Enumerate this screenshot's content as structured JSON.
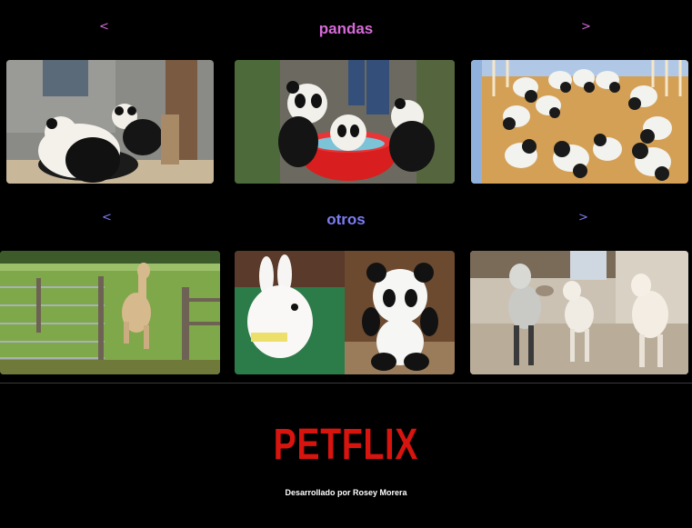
{
  "rows": [
    {
      "title": "pandas",
      "prev": "<",
      "next": ">",
      "color": "#d66ad9",
      "cards": [
        "panda-enclosure-photo",
        "pandas-in-red-tub-photo",
        "panda-cubs-nursery-photo"
      ]
    },
    {
      "title": "otros",
      "prev": "<",
      "next": ">",
      "color": "#7c7cf4",
      "cards": [
        "alpaca-jumping-photo",
        "bunny-and-panda-plush-photo",
        "baby-goats-photo"
      ]
    }
  ],
  "footer": {
    "logo": "PETFLIX",
    "credit": "Desarrollado por Rosey Morera",
    "logo_color": "#d8140f"
  }
}
